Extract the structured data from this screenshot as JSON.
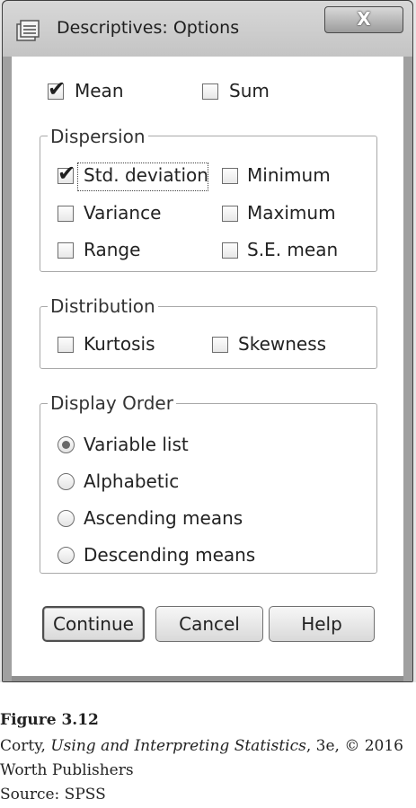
{
  "window": {
    "title": "Descriptives: Options",
    "close_label": "X"
  },
  "top_options": {
    "mean": {
      "label": "Mean",
      "checked": true
    },
    "sum": {
      "label": "Sum",
      "checked": false
    }
  },
  "dispersion": {
    "legend": "Dispersion",
    "items": [
      {
        "label": "Std. deviation",
        "checked": true
      },
      {
        "label": "Minimum",
        "checked": false
      },
      {
        "label": "Variance",
        "checked": false
      },
      {
        "label": "Maximum",
        "checked": false
      },
      {
        "label": "Range",
        "checked": false
      },
      {
        "label": "S.E. mean",
        "checked": false
      }
    ]
  },
  "distribution": {
    "legend": "Distribution",
    "items": [
      {
        "label": "Kurtosis",
        "checked": false
      },
      {
        "label": "Skewness",
        "checked": false
      }
    ]
  },
  "display_order": {
    "legend": "Display Order",
    "selected": "Variable list",
    "options": [
      {
        "label": "Variable list"
      },
      {
        "label": "Alphabetic"
      },
      {
        "label": "Ascending means"
      },
      {
        "label": "Descending means"
      }
    ]
  },
  "buttons": {
    "continue": "Continue",
    "cancel": "Cancel",
    "help": "Help"
  },
  "caption": {
    "figure": "Figure 3.12",
    "line1_author": "Corty, ",
    "line1_title": "Using and Interpreting Statistics",
    "line1_rest": ", 3e, © 2016",
    "line2": "Worth Publishers",
    "line3": "Source: SPSS"
  },
  "colors": {
    "window_frame": "#8f8f8f",
    "client_background": "#ffffff",
    "group_border": "#a9a9a9"
  }
}
